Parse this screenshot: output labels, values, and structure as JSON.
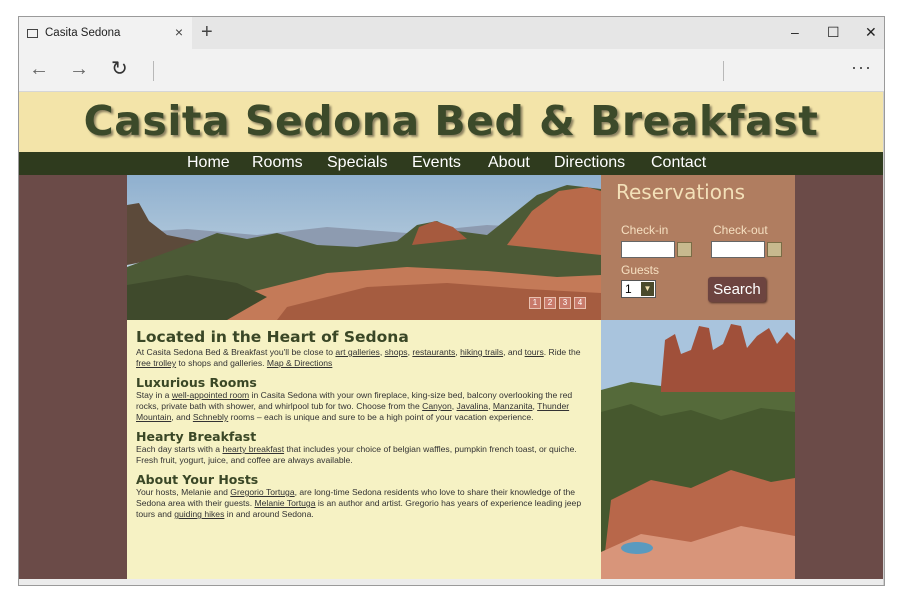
{
  "browser": {
    "tab_title": "Casita Sedona",
    "new_tab": "+",
    "tab_close": "×",
    "minimize": "–",
    "maximize": "☐",
    "close": "✕",
    "back": "←",
    "forward": "→",
    "refresh": "↻",
    "more": "···"
  },
  "site": {
    "title": "Casita Sedona Bed & Breakfast",
    "nav": [
      "Home",
      "Rooms",
      "Specials",
      "Events",
      "About",
      "Directions",
      "Contact"
    ]
  },
  "slideshow": {
    "indicators": [
      "1",
      "2",
      "3",
      "4"
    ]
  },
  "reservations": {
    "title": "Reservations",
    "checkin_label": "Check-in",
    "checkout_label": "Check-out",
    "checkin_value": "",
    "checkout_value": "",
    "guests_label": "Guests",
    "guests_value": "1",
    "search_label": "Search"
  },
  "sections": {
    "located": {
      "heading": "Located in the Heart of Sedona",
      "t1": "At Casita Sedona Bed & Breakfast you'll be close to ",
      "art_galleries": "art galleries",
      "t2": ", ",
      "shops": "shops",
      "t3": ", ",
      "restaurants": "restaurants",
      "t4": ", ",
      "hiking_trails": "hiking trails",
      "t5": ", and ",
      "tours": "tours",
      "t6": ". Ride the ",
      "free_trolley": "free trolley",
      "t7": " to shops and galleries.  ",
      "map_directions": "Map & Directions"
    },
    "rooms": {
      "heading": "Luxurious Rooms",
      "t1": "Stay in a ",
      "well_appointed": "well-appointed room",
      "t2": " in Casita Sedona with your own fireplace, king-size bed, balcony overlooking the red rocks, private bath with shower, and whirlpool tub for two. Choose from the ",
      "canyon": "Canyon",
      "t3": ", ",
      "javalina": "Javalina",
      "t4": ", ",
      "manzanita": "Manzanita",
      "t5": ", ",
      "thunder_mountain": "Thunder Mountain",
      "t6": ", and ",
      "schnebly": "Schnebly",
      "t7": " rooms – each is unique and sure to be a high point of your vacation experience."
    },
    "breakfast": {
      "heading": "Hearty Breakfast",
      "t1": "Each day starts with a ",
      "hearty_breakfast": "hearty breakfast",
      "t2": " that includes your choice of belgian waffles, pumpkin french toast, or quiche. Fresh fruit, yogurt, juice, and coffee are always available."
    },
    "hosts": {
      "heading": "About Your Hosts",
      "t1": "Your hosts, Melanie and ",
      "gregorio": "Gregorio Tortuga",
      "t2": ", are long-time Sedona residents who love to share their knowledge of the Sedona area with their guests. ",
      "melanie": "Melanie Tortuga",
      "t3": " is an author and artist. Gregorio has years of experience leading jeep tours and ",
      "guiding_hikes": "guiding hikes",
      "t4": " in and around Sedona."
    }
  },
  "colors": {
    "header_bg": "#f3e4a9",
    "title_text": "#3c4a2a",
    "nav_bg": "#2f3b1e",
    "page_bg": "#6b4b48",
    "reservations_bg": "#b07d60",
    "content_bg": "#f6f2c4",
    "search_button": "#6d4440"
  }
}
